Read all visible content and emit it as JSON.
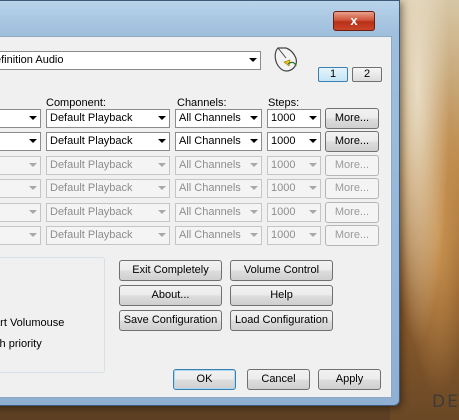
{
  "window": {
    "close_glyph": "x"
  },
  "device": {
    "selected": "efinition Audio"
  },
  "pages": [
    "1",
    "2"
  ],
  "columns": {
    "component": "Component:",
    "channels": "Channels:",
    "steps": "Steps:"
  },
  "rows": [
    {
      "component": "Default Playback",
      "channels": "All Channels",
      "steps": "1000",
      "more": "More...",
      "enabled": true
    },
    {
      "component": "Default Playback",
      "channels": "All Channels",
      "steps": "1000",
      "more": "More...",
      "enabled": true
    },
    {
      "component": "Default Playback",
      "channels": "All Channels",
      "steps": "1000",
      "more": "More...",
      "enabled": false
    },
    {
      "component": "Default Playback",
      "channels": "All Channels",
      "steps": "1000",
      "more": "More...",
      "enabled": false
    },
    {
      "component": "Default Playback",
      "channels": "All Channels",
      "steps": "1000",
      "more": "More...",
      "enabled": false
    },
    {
      "component": "Default Playback",
      "channels": "All Channels",
      "steps": "1000",
      "more": "More...",
      "enabled": false
    }
  ],
  "options": {
    "restart_label": "tart Volumouse",
    "priority_label": "igh priority"
  },
  "actions": {
    "exit": "Exit Completely",
    "volume_control": "Volume Control",
    "about": "About...",
    "help": "Help",
    "save_config": "Save Configuration",
    "load_config": "Load Configuration"
  },
  "dialog": {
    "ok": "OK",
    "cancel": "Cancel",
    "apply": "Apply"
  },
  "wallpaper_text": "DE"
}
